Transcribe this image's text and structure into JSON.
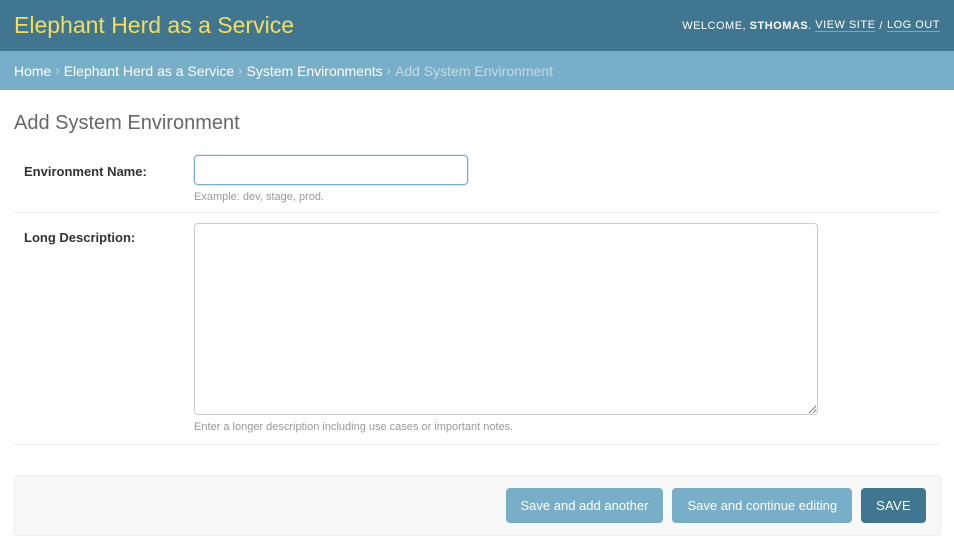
{
  "header": {
    "site_title": "Elephant Herd as a Service",
    "welcome": "WELCOME,",
    "username": "STHOMAS",
    "username_suffix": ".",
    "view_site": "VIEW SITE",
    "separator": "/",
    "log_out": "LOG OUT"
  },
  "breadcrumbs": {
    "items": [
      "Home",
      "Elephant Herd as a Service",
      "System Environments"
    ],
    "current": "Add System Environment",
    "separator": "›"
  },
  "page": {
    "title": "Add System Environment"
  },
  "form": {
    "environment_name": {
      "label": "Environment Name:",
      "value": "",
      "help": "Example: dev, stage, prod."
    },
    "long_description": {
      "label": "Long Description:",
      "value": "",
      "help": "Enter a longer description including use cases or important notes."
    }
  },
  "actions": {
    "save_add_another": "Save and add another",
    "save_continue": "Save and continue editing",
    "save": "SAVE"
  },
  "colors": {
    "header_bg": "#417690",
    "brand_text": "#f5dd5d",
    "breadcrumb_bg": "#79aec8",
    "button_secondary": "#79aec8",
    "button_primary": "#417690"
  }
}
